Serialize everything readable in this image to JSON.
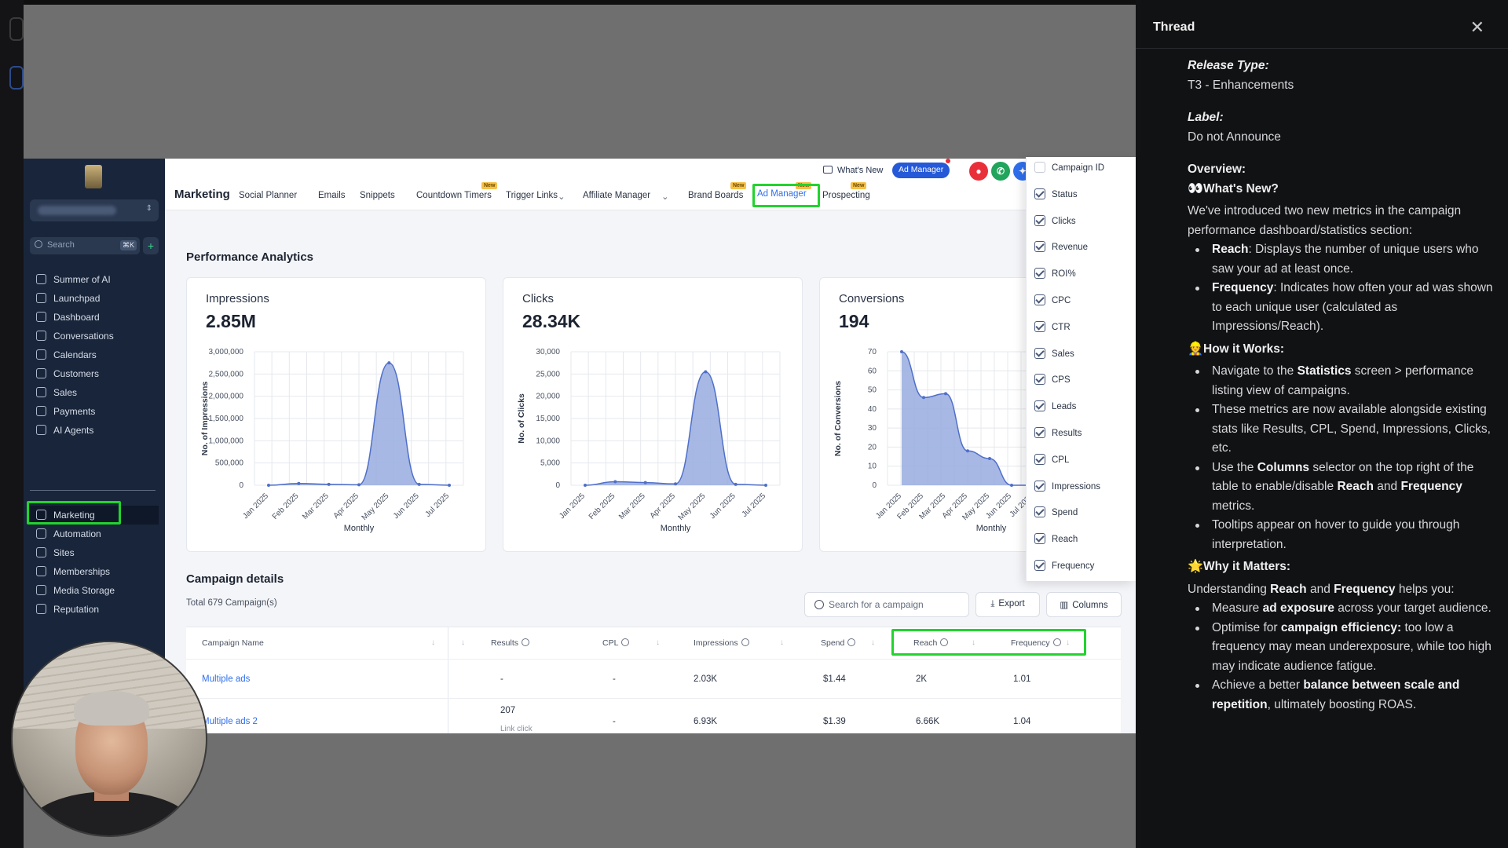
{
  "app": {
    "sidebar": {
      "search_placeholder": "Search",
      "search_kbd": "⌘K",
      "add": "+",
      "items": [
        {
          "label": "Summer of AI",
          "icon": "sparkle-icon"
        },
        {
          "label": "Launchpad",
          "icon": "rocket-icon"
        },
        {
          "label": "Dashboard",
          "icon": "dashboard-icon"
        },
        {
          "label": "Conversations",
          "icon": "chat-icon"
        },
        {
          "label": "Calendars",
          "icon": "calendar-icon"
        },
        {
          "label": "Customers",
          "icon": "contacts-icon"
        },
        {
          "label": "Sales",
          "icon": "sales-icon"
        },
        {
          "label": "Payments",
          "icon": "payments-icon"
        },
        {
          "label": "AI Agents",
          "icon": "ai-agents-icon"
        }
      ],
      "items2": [
        {
          "label": "Marketing",
          "icon": "send-icon",
          "active": true
        },
        {
          "label": "Automation",
          "icon": "automation-icon"
        },
        {
          "label": "Sites",
          "icon": "sites-icon"
        },
        {
          "label": "Memberships",
          "icon": "memberships-icon"
        },
        {
          "label": "Media Storage",
          "icon": "media-icon"
        },
        {
          "label": "Reputation",
          "icon": "star-icon"
        }
      ]
    },
    "topnav": {
      "title": "Marketing",
      "tabs": [
        "Social Planner",
        "Emails",
        "Snippets",
        "Countdown Timers",
        "Trigger Links",
        "Affiliate Manager",
        "Brand Boards",
        "Ad Manager",
        "Prospecting"
      ],
      "new_badge": "New",
      "whats_new": "What's New",
      "ad_manager_pill": "Ad Manager"
    },
    "analytics": {
      "title": "Performance Analytics",
      "cards": [
        {
          "title": "Impressions",
          "value": "2.85M",
          "ylabel": "No. of Impressions",
          "xlabel": "Monthly",
          "yticks": [
            "3,000,000",
            "2,500,000",
            "2,000,000",
            "1,500,000",
            "1,000,000",
            "500,000",
            "0"
          ]
        },
        {
          "title": "Clicks",
          "value": "28.34K",
          "ylabel": "No. of Clicks",
          "xlabel": "Monthly",
          "yticks": [
            "30,000",
            "25,000",
            "20,000",
            "15,000",
            "10,000",
            "5,000",
            "0"
          ]
        },
        {
          "title": "Conversions",
          "value": "194",
          "ylabel": "No. of Conversions",
          "xlabel": "Monthly",
          "yticks": [
            "70",
            "60",
            "50",
            "40",
            "30",
            "20",
            "10",
            "0"
          ]
        }
      ],
      "months": [
        "Jan 2025",
        "Feb 2025",
        "Mar 2025",
        "Apr 2025",
        "May 2025",
        "Jun 2025",
        "Jul 2025"
      ]
    },
    "campaigns": {
      "title": "Campaign details",
      "total": "Total 679 Campaign(s)",
      "search_placeholder": "Search for a campaign",
      "export": "Export",
      "columns": "Columns",
      "headers": [
        "Campaign Name",
        "Results",
        "CPL",
        "Impressions",
        "Spend",
        "Reach",
        "Frequency"
      ],
      "rows": [
        {
          "name": "Multiple ads",
          "results": "-",
          "results_sub": "",
          "cpl": "-",
          "impressions": "2.03K",
          "spend": "$1.44",
          "reach": "2K",
          "frequency": "1.01"
        },
        {
          "name": "Multiple ads 2",
          "results": "207",
          "results_sub": "Link click",
          "cpl": "-",
          "impressions": "6.93K",
          "spend": "$1.39",
          "reach": "6.66K",
          "frequency": "1.04"
        }
      ]
    },
    "column_options": [
      {
        "label": "Campaign ID",
        "checked": false
      },
      {
        "label": "Status",
        "checked": true
      },
      {
        "label": "Clicks",
        "checked": true
      },
      {
        "label": "Revenue",
        "checked": true
      },
      {
        "label": "ROI%",
        "checked": true
      },
      {
        "label": "CPC",
        "checked": true
      },
      {
        "label": "CTR",
        "checked": true
      },
      {
        "label": "Sales",
        "checked": true
      },
      {
        "label": "CPS",
        "checked": true
      },
      {
        "label": "Leads",
        "checked": true
      },
      {
        "label": "Results",
        "checked": true
      },
      {
        "label": "CPL",
        "checked": true
      },
      {
        "label": "Impressions",
        "checked": true
      },
      {
        "label": "Spend",
        "checked": true
      },
      {
        "label": "Reach",
        "checked": true
      },
      {
        "label": "Frequency",
        "checked": true
      }
    ]
  },
  "chart_data": [
    {
      "type": "area",
      "title": "Impressions",
      "xlabel": "Monthly",
      "ylabel": "No. of Impressions",
      "x": [
        "Jan 2025",
        "Feb 2025",
        "Mar 2025",
        "Apr 2025",
        "May 2025",
        "Jun 2025",
        "Jul 2025"
      ],
      "values": [
        0,
        40000,
        20000,
        10000,
        2750000,
        20000,
        0
      ],
      "ylim": [
        0,
        3000000
      ]
    },
    {
      "type": "area",
      "title": "Clicks",
      "xlabel": "Monthly",
      "ylabel": "No. of Clicks",
      "x": [
        "Jan 2025",
        "Feb 2025",
        "Mar 2025",
        "Apr 2025",
        "May 2025",
        "Jun 2025",
        "Jul 2025"
      ],
      "values": [
        0,
        800,
        600,
        300,
        25500,
        200,
        0
      ],
      "ylim": [
        0,
        30000
      ]
    },
    {
      "type": "area",
      "title": "Conversions",
      "xlabel": "Monthly",
      "ylabel": "No. of Conversions",
      "x": [
        "Jan 2025",
        "Feb 2025",
        "Mar 2025",
        "Apr 2025",
        "May 2025",
        "Jun 2025",
        "Jul 2025"
      ],
      "values": [
        70,
        46,
        48,
        18,
        14,
        0,
        0
      ],
      "ylim": [
        0,
        70
      ]
    }
  ],
  "thread": {
    "title": "Thread",
    "release_type_label": "Release Type:",
    "release_type": "T3 - Enhancements",
    "label_label": "Label:",
    "label": "Do not Announce",
    "overview_label": "Overview:",
    "whats_new_heading": "What's New?",
    "intro": "We've introduced two new metrics in the campaign performance dashboard/statistics section:",
    "reach_term": "Reach",
    "reach_desc": ": Displays the number of unique users who saw your ad at least once.",
    "freq_term": "Frequency",
    "freq_desc": ": Indicates how often your ad was shown to each unique user (calculated as Impressions/Reach).",
    "how_heading": "How it Works:",
    "how_1a": "Navigate to the ",
    "how_1b": "Statistics",
    "how_1c": " screen > performance listing view of campaigns.",
    "how_2": "These metrics are now available alongside existing stats like Results, CPL, Spend, Impressions, Clicks, etc.",
    "how_3a": "Use the ",
    "how_3b": "Columns",
    "how_3c": " selector on the top right of the table to enable/disable ",
    "how_3d": "Reach",
    "how_3e": " and ",
    "how_3f": "Frequency",
    "how_3g": " metrics.",
    "how_4": "Tooltips appear on hover to guide you through interpretation.",
    "why_heading": "Why it Matters:",
    "why_intro_a": "Understanding ",
    "why_intro_b": "Reach",
    "why_intro_c": " and ",
    "why_intro_d": "Frequency",
    "why_intro_e": " helps you:",
    "why_1a": "Measure ",
    "why_1b": "ad exposure",
    "why_1c": " across your target audience.",
    "why_2a": "Optimise for ",
    "why_2b": "campaign efficiency:",
    "why_2c": " too low a frequency may mean underexposure, while too high may indicate audience fatigue.",
    "why_3a": "Achieve a better ",
    "why_3b": "balance between scale and repetition",
    "why_3c": ", ultimately boosting ROAS."
  }
}
